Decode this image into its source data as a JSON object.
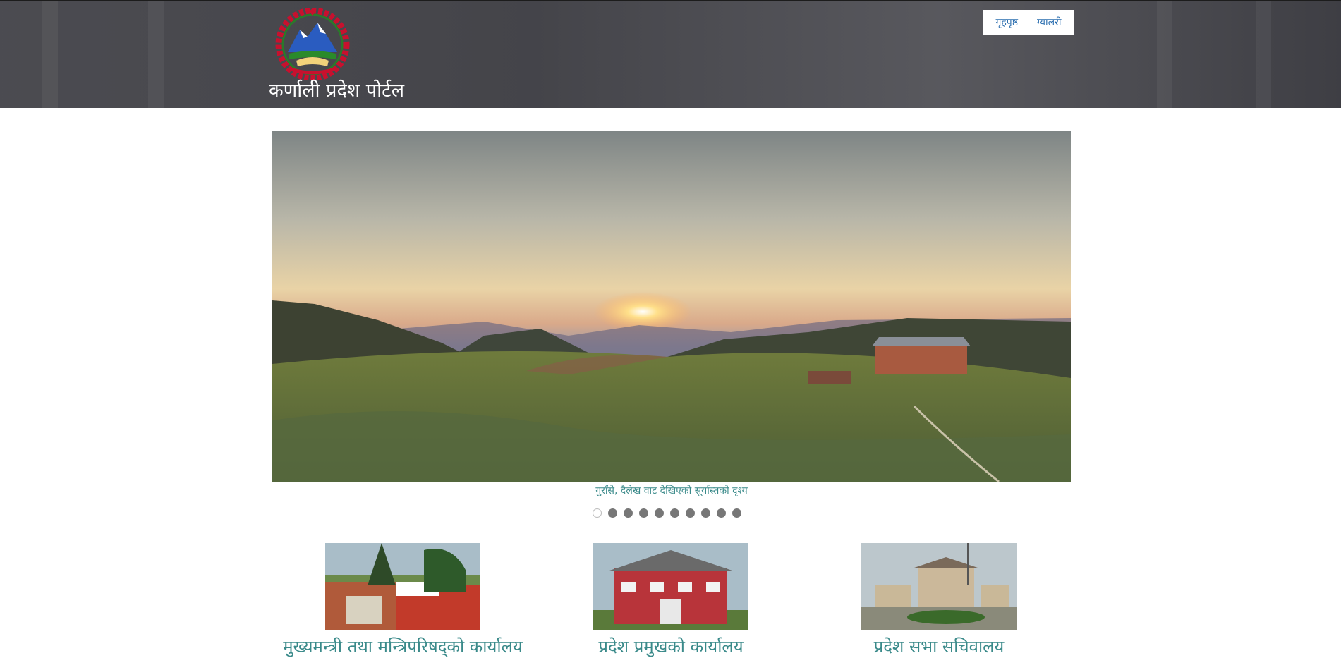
{
  "header": {
    "title": "कर्णाली प्रदेश पोर्टल",
    "nav": [
      {
        "label": "गृहपृष्ठ"
      },
      {
        "label": "ग्यालरी"
      }
    ]
  },
  "slider": {
    "caption": "गुराँसे, दैलेख वाट देखिएको सूर्यास्तको दृश्य",
    "dot_count": 10,
    "active_dot": 1
  },
  "cards": [
    {
      "title": "मुख्यमन्त्री तथा मन्त्रिपरिषद्को कार्यालय"
    },
    {
      "title": "प्रदेश प्रमुखको कार्यालय"
    },
    {
      "title": "प्रदेश सभा सचिवालय"
    }
  ],
  "colors": {
    "header_bg": "#38383e",
    "link": "#2c6fb0",
    "accent_teal": "#3a8a8a"
  }
}
